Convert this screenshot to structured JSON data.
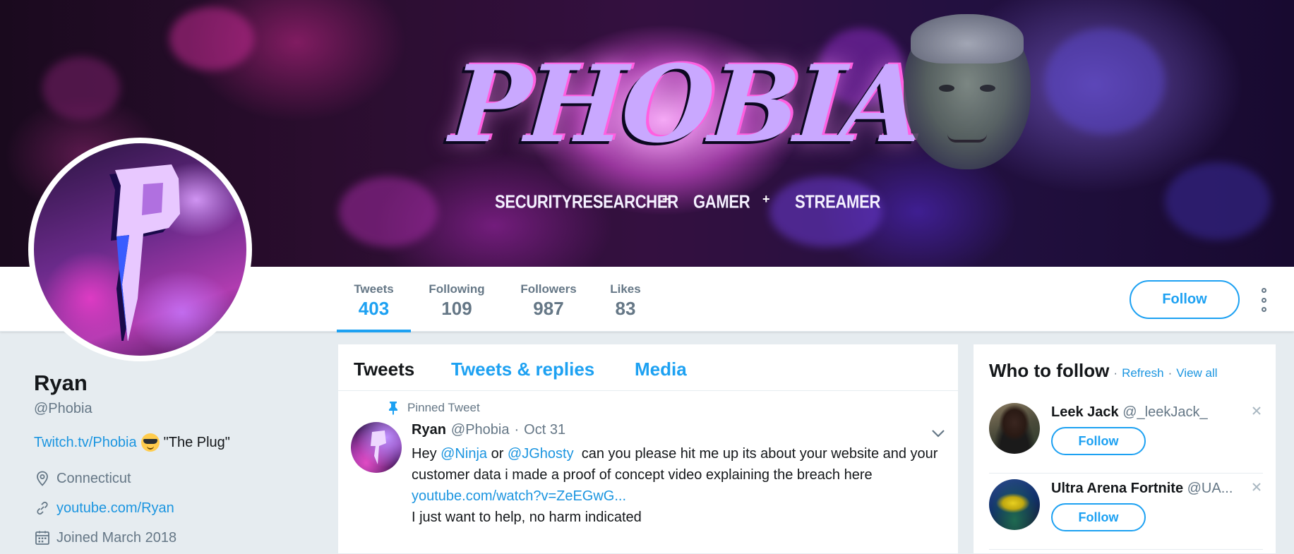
{
  "banner": {
    "title": "PHOBIA",
    "subtitle_items": [
      "SECURITYRESEARCHER",
      "GAMER",
      "STREAMER"
    ],
    "separator": "+"
  },
  "nav": {
    "stats": [
      {
        "label": "Tweets",
        "value": "403"
      },
      {
        "label": "Following",
        "value": "109"
      },
      {
        "label": "Followers",
        "value": "987"
      },
      {
        "label": "Likes",
        "value": "83"
      }
    ],
    "active_stat": "Tweets",
    "follow_label": "Follow"
  },
  "profile": {
    "name": "Ryan",
    "handle": "@Phobia",
    "bio_link": "Twitch.tv/Phobia",
    "bio_text": "\"The Plug\"",
    "location": "Connecticut",
    "website": "youtube.com/Ryan",
    "joined": "Joined March 2018"
  },
  "timeline": {
    "tabs": [
      "Tweets",
      "Tweets & replies",
      "Media"
    ],
    "active_tab": "Tweets",
    "pinned_label": "Pinned Tweet",
    "tweet": {
      "name": "Ryan",
      "handle": "@Phobia",
      "separator": "·",
      "date": "Oct 31",
      "text_1": "Hey ",
      "mention_1": "@Ninja",
      "text_2": " or ",
      "mention_2": "@JGhosty",
      "text_3": "  can you please hit me up its about your website and your customer data i made a proof of concept video explaining the breach here",
      "url": "youtube.com/watch?v=ZeEGwG...",
      "text_4": "I just want to help, no harm indicated"
    }
  },
  "who_to_follow": {
    "title": "Who to follow",
    "dot": "·",
    "refresh": "Refresh",
    "view_all": "View all",
    "items": [
      {
        "name": "Leek Jack",
        "handle": "@_leekJack_",
        "follow_label": "Follow"
      },
      {
        "name": "Ultra Arena Fortnite",
        "handle": "@UA...",
        "follow_label": "Follow"
      }
    ]
  },
  "colors": {
    "accent": "#1da1f2",
    "link": "#1b95e0",
    "muted": "#657786",
    "text": "#14171a",
    "background": "#e6ecf0"
  },
  "icons": [
    "location-icon",
    "link-icon",
    "calendar-icon",
    "pin-icon",
    "chevron-down-icon",
    "close-icon",
    "more-icon"
  ]
}
